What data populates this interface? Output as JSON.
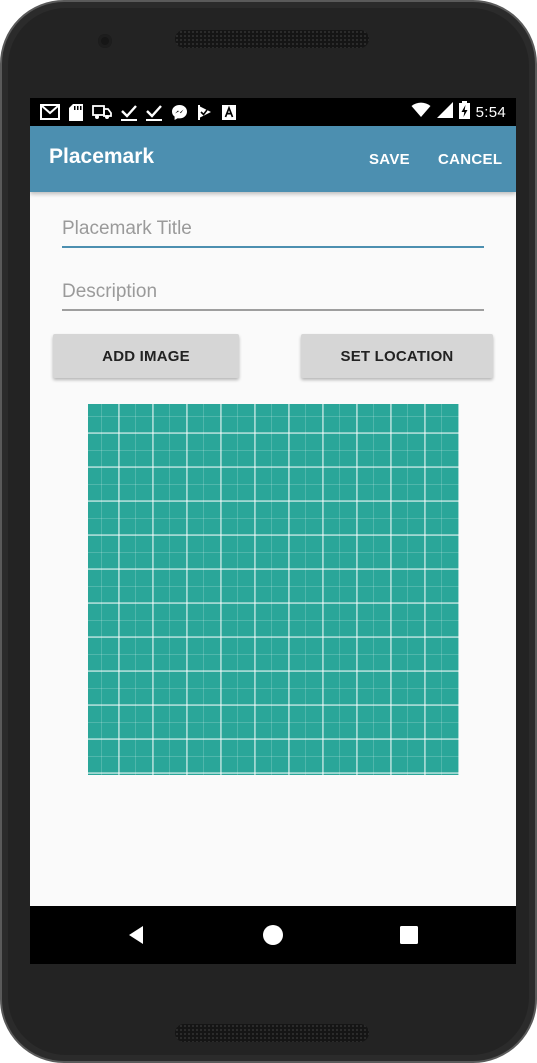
{
  "status_bar": {
    "time": "5:54",
    "left_icons": [
      "gmail-icon",
      "sd-card-icon",
      "car-icon",
      "check-icon",
      "check-icon",
      "messenger-icon",
      "check-flag-icon",
      "font-a-icon"
    ],
    "right_icons": [
      "wifi-icon",
      "cell-signal-icon",
      "battery-charging-icon"
    ]
  },
  "app_bar": {
    "title": "Placemark",
    "actions": {
      "save": "SAVE",
      "cancel": "CANCEL"
    },
    "color": "#4c8fb0"
  },
  "form": {
    "title_field": {
      "placeholder": "Placemark Title",
      "value": ""
    },
    "description_field": {
      "placeholder": "Description",
      "value": ""
    },
    "add_image_label": "ADD IMAGE",
    "set_location_label": "SET LOCATION"
  },
  "image_preview": {
    "icon": "teal-grid-placeholder-image",
    "color": "#2aa699"
  },
  "nav_bar": {
    "icons": [
      "back-icon",
      "home-icon",
      "recents-icon"
    ]
  }
}
